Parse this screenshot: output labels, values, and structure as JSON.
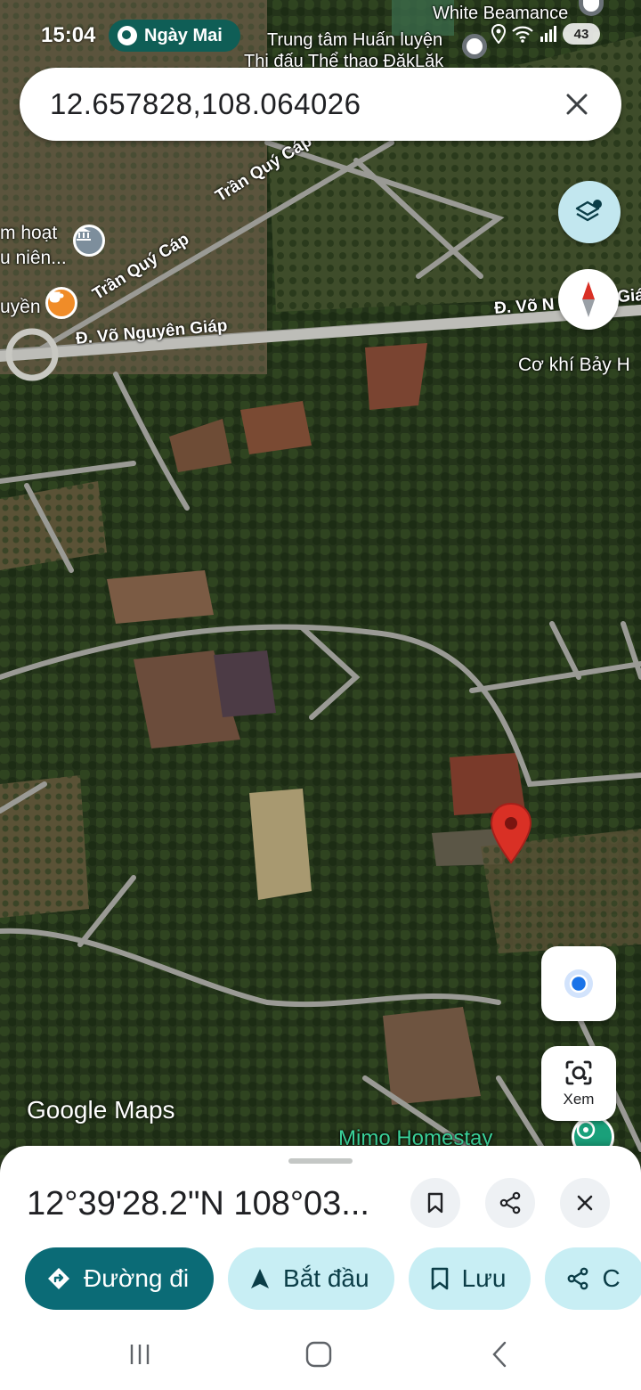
{
  "status_bar": {
    "time": "15:04",
    "weather_label": "Ngày Mai",
    "battery": "43"
  },
  "search": {
    "value": "12.657828,108.064026"
  },
  "map_labels": {
    "white_beamance": "White Beamance",
    "training_center_line1": "Trung tâm Huấn luyện",
    "training_center_line2": "Thi đấu Thể thao ĐăkLăk",
    "tran_quy_cap_1": "Trần Quý Cáp",
    "tran_quy_cap_2": "Trần Quý Cáp",
    "activity_line1": "m hoạt",
    "activity_line2": "u niên...",
    "uyen": "uyền",
    "vo_nguyen_giap_left": "Đ. Võ Nguyên Giáp",
    "vo_nguyen_giap_right": "Đ. Võ N",
    "vo_nguyen_giap_right_tail": "Giá",
    "co_khi": "Cơ khí Bảy H",
    "mimo_homestay": "Mimo Homestay",
    "google_maps": "Google Maps"
  },
  "controls": {
    "lens_label": "Xem"
  },
  "sheet": {
    "title": "12°39'28.2\"N 108°03...",
    "chips": {
      "directions": "Đường đi",
      "start": "Bắt đầu",
      "save": "Lưu",
      "share_partial": "C"
    }
  },
  "colors": {
    "primary": "#0b6b76",
    "secondary_chip": "#c8eef4",
    "pin": "#d93025",
    "location_dot": "#1a73e8"
  }
}
